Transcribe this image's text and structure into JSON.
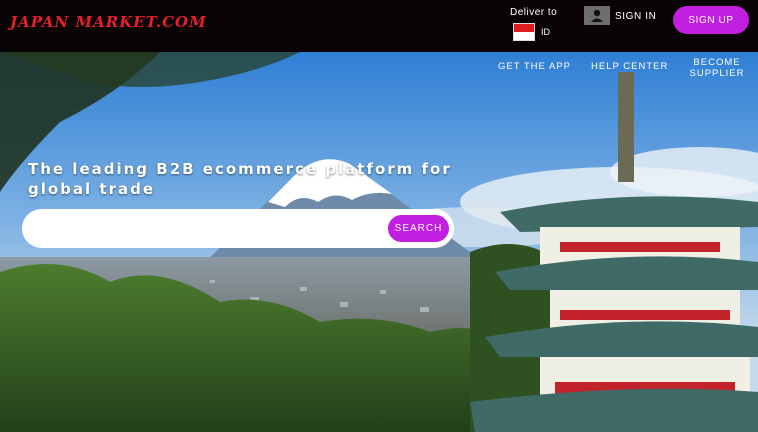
{
  "header": {
    "logo": "JAPAN MARKET.COM",
    "deliver_label": "Deliver to",
    "country_code": "ID",
    "sign_in": "SIGN IN",
    "sign_up": "SIGN UP"
  },
  "nav": {
    "get_app": "GET THE  APP",
    "help_center": "HELP CENTER",
    "become_supplier": "BECOME SUPPLIER"
  },
  "hero": {
    "headline": "The leading B2B ecommerce platform for global trade",
    "search_placeholder": "",
    "search_button": "SEARCH"
  },
  "colors": {
    "accent": "#c21ee0",
    "logo_red": "#e5202a",
    "topbar": "#090305"
  },
  "icons": [
    "user-icon",
    "indonesia-flag-icon"
  ]
}
